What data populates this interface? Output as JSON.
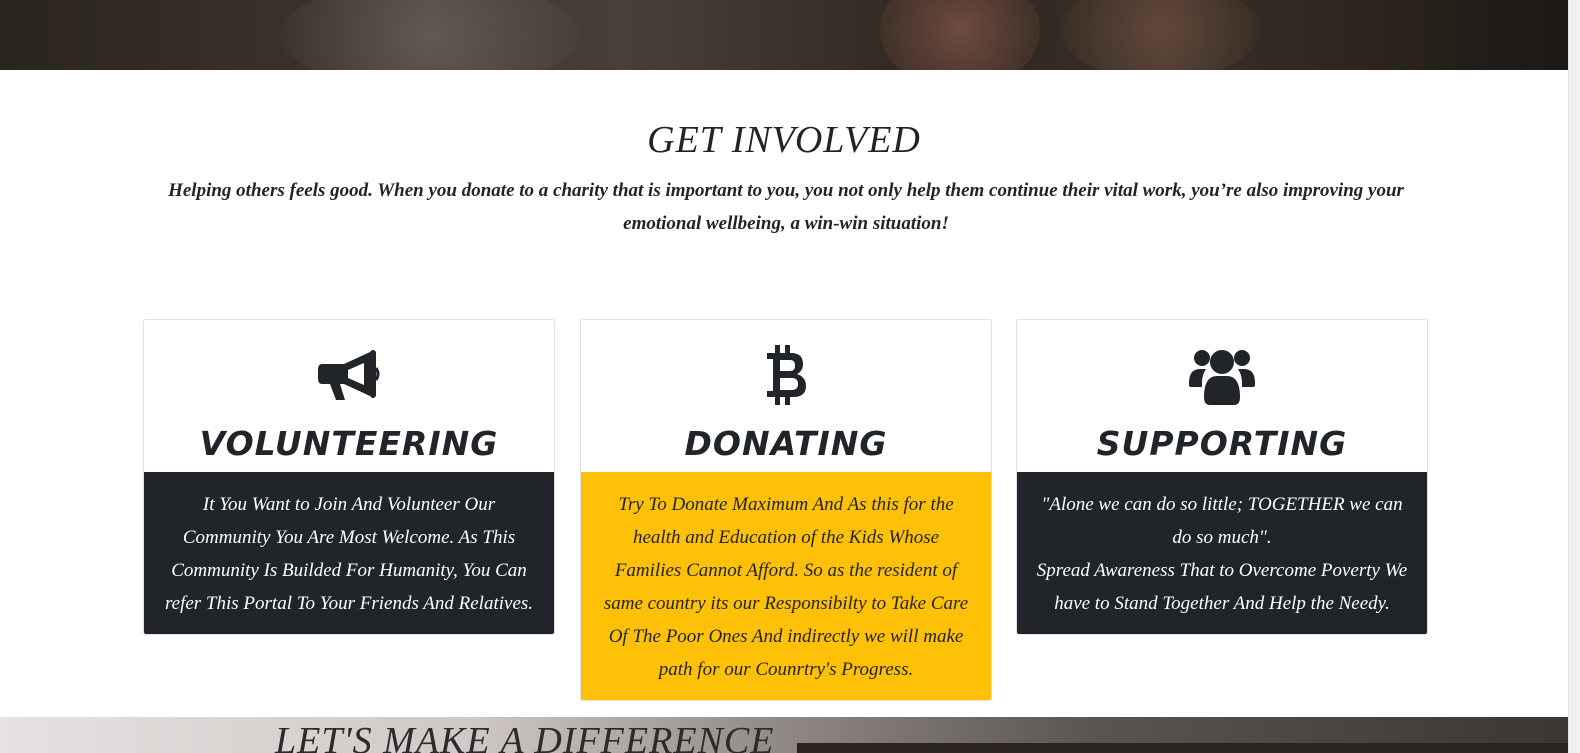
{
  "section": {
    "title": "GET INVOLVED",
    "description": "Helping others feels good. When you donate to a charity that is important to you, you not only help them continue their vital work, you’re also improving your emotional wellbeing, a win-win situation!"
  },
  "cards": [
    {
      "icon": "megaphone-icon",
      "title": "VOLUNTEERING",
      "body": [
        "It You Want to Join And Volunteer Our Community You Are Most Welcome. As This Community Is Builded For Humanity, You Can refer This Portal To Your Friends And Relatives."
      ],
      "body_color": "#212529"
    },
    {
      "icon": "bitcoin-icon",
      "title": "DONATING",
      "body": [
        "Try To Donate Maximum And As this for the health and Education of the Kids Whose Families Cannot Afford. So as the resident of same country its our Responsibilty to Take Care Of The Poor Ones And indirectly we will make path for our Counrtry's Progress."
      ],
      "body_color": "#ffc107"
    },
    {
      "icon": "users-icon",
      "title": "SUPPORTING",
      "body": [
        "\"Alone we can do so little; TOGETHER we can do so much\".",
        "Spread Awareness That to Overcome Poverty We have to Stand Together And Help the Needy."
      ],
      "body_color": "#212529"
    }
  ],
  "next_section": {
    "title": "LET'S MAKE A DIFFERENCE"
  }
}
